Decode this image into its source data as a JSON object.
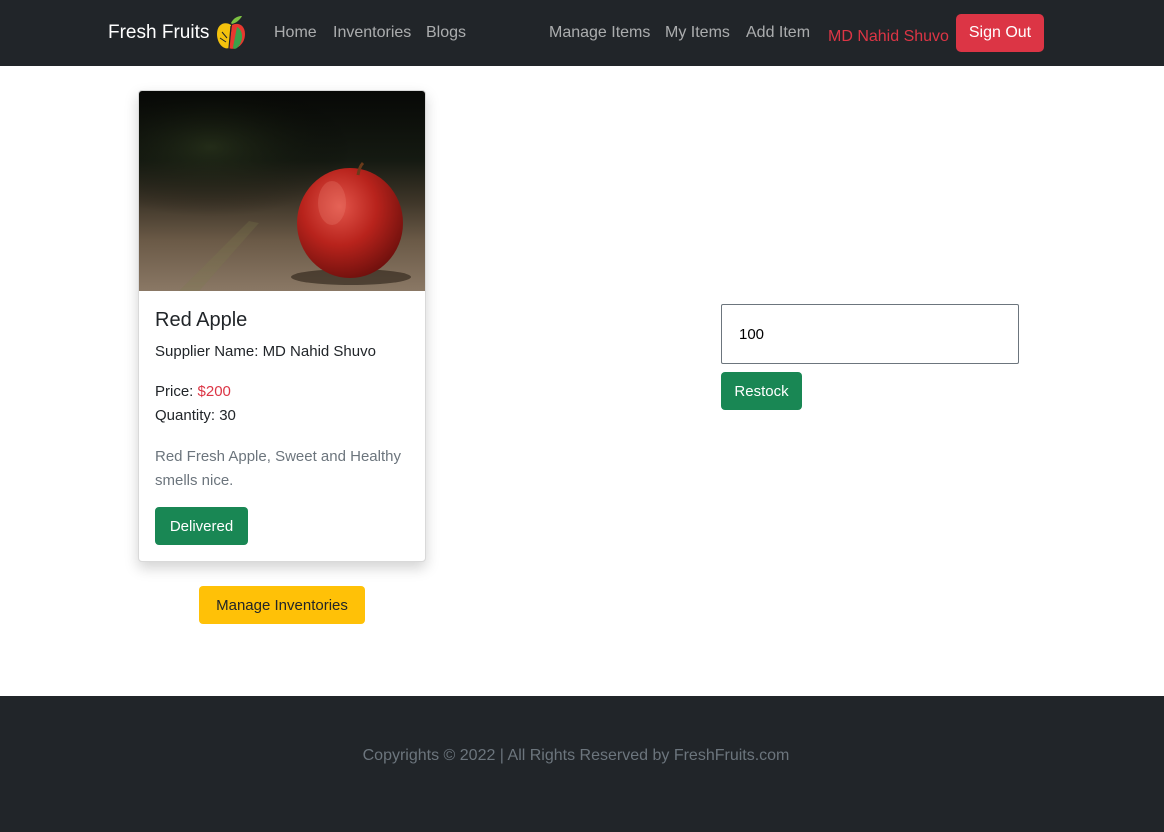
{
  "navbar": {
    "brand": "Fresh Fruits",
    "brand_icon": "apple-logo-icon",
    "left_links": [
      "Home",
      "Inventories",
      "Blogs"
    ],
    "right_links": [
      "Manage Items",
      "My Items",
      "Add Item"
    ],
    "user_name": "MD Nahid Shuvo",
    "sign_out_label": "Sign Out",
    "bg_color": "#212529"
  },
  "item": {
    "image_icon": "red-apple-photo",
    "name": "Red Apple",
    "supplier_label": "Supplier Name: ",
    "supplier": "MD Nahid Shuvo",
    "price_label": "Price: ",
    "price": "$200",
    "quantity_label": "Quantity: ",
    "quantity": "30",
    "description": "Red Fresh Apple, Sweet and Healthy smells nice.",
    "delivered_label": "Delivered"
  },
  "manage_inventories_label": "Manage Inventories",
  "restock": {
    "value": "100",
    "button_label": "Restock"
  },
  "footer": {
    "text": "Copyrights © 2022 | All Rights Reserved by FreshFruits.com"
  },
  "colors": {
    "danger": "#dc3545",
    "success": "#198754",
    "warning": "#ffc107",
    "muted": "#6c757d"
  }
}
